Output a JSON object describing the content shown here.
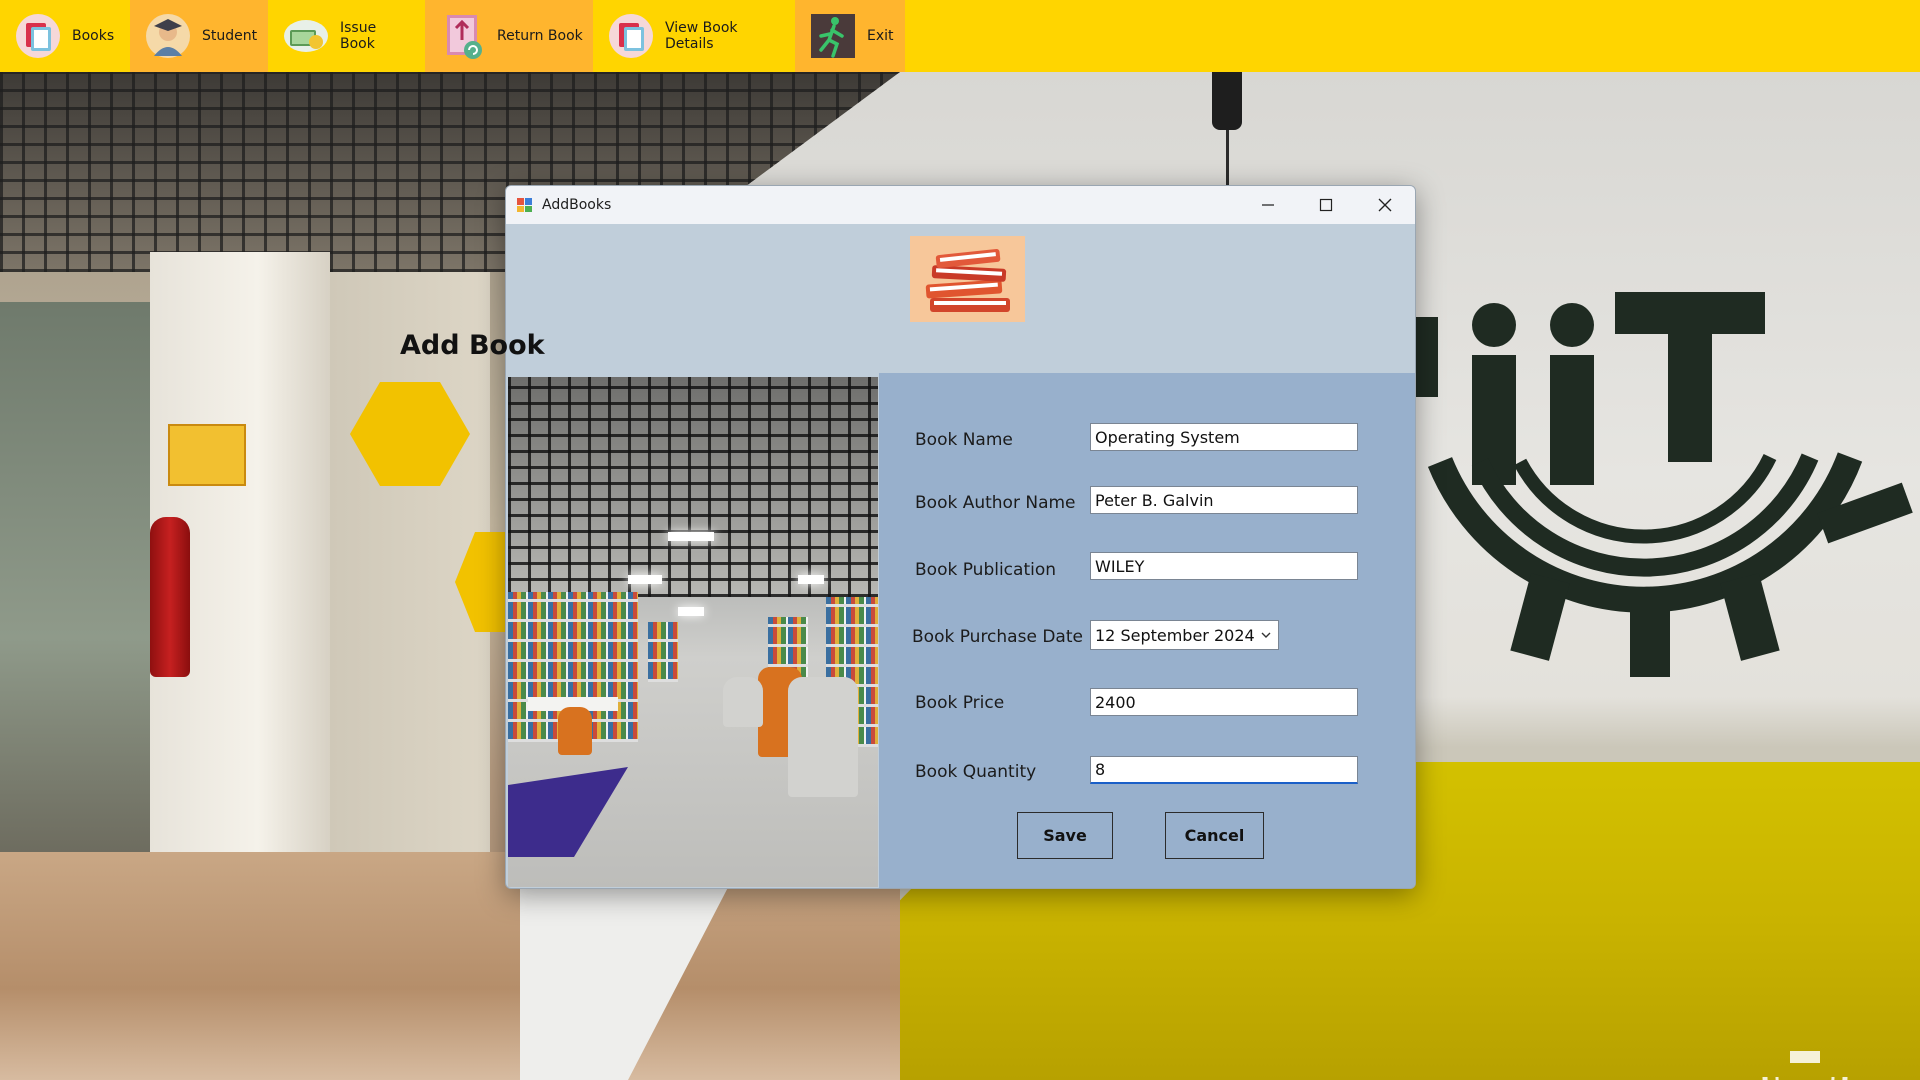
{
  "menu": {
    "items": [
      {
        "label": "Books",
        "icon": "books-icon",
        "active": false
      },
      {
        "label": "Student",
        "icon": "student-icon",
        "active": true
      },
      {
        "label": "Issue Book",
        "icon": "issue-book-icon",
        "active": false
      },
      {
        "label": "Return Book",
        "icon": "return-book-icon",
        "active": true
      },
      {
        "label": "View Book Details",
        "icon": "view-book-details-icon",
        "active": false
      },
      {
        "label": "Exit",
        "icon": "exit-icon",
        "active": true
      }
    ],
    "bar_color": "#ffd500",
    "active_color": "#ffb52e"
  },
  "window": {
    "title": "AddBooks",
    "title_icon": "app-icon",
    "controls": [
      "minimize-icon",
      "maximize-icon",
      "close-icon"
    ]
  },
  "form": {
    "heading": "Add Book",
    "hero_icon": "book-stack-icon",
    "fields": {
      "book_name": {
        "label": "Book Name",
        "value": "Operating System"
      },
      "author": {
        "label": "Book Author Name",
        "value": "Peter B. Galvin"
      },
      "publication": {
        "label": "Book Publication",
        "value": "WILEY"
      },
      "purchase_date": {
        "label": "Book Purchase Date",
        "value": "12 September 2024"
      },
      "price": {
        "label": "Book Price",
        "value": "2400"
      },
      "quantity": {
        "label": "Book Quantity",
        "value": "8"
      }
    },
    "buttons": {
      "save": "Save",
      "cancel": "Cancel"
    },
    "panel_color": "#98b0cc",
    "header_color": "#c0ceda"
  }
}
